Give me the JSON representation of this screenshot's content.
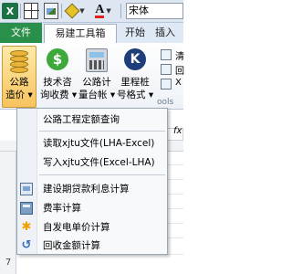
{
  "qat": {
    "excel_icon": "X",
    "font_name": "宋体",
    "font_color_glyph": "A",
    "icons": [
      "excel-icon",
      "border-icon",
      "picture-icon",
      "fill-color-icon",
      "font-color-icon"
    ],
    "colors": {
      "font_color_bar": "#e0201b",
      "excel_green": "#1e7145"
    }
  },
  "tabs": {
    "file": "文件",
    "addin": "易建工具箱",
    "home": "开始",
    "insert": "插入"
  },
  "ribbon": {
    "buttons": [
      {
        "line1": "公路",
        "line2": "造价 ▾",
        "icon": "coins-icon"
      },
      {
        "line1": "技术咨",
        "line2": "询收费 ▾",
        "icon": "dollar-icon"
      },
      {
        "line1": "公路计",
        "line2": "量台帐 ▾",
        "icon": "calculator-icon"
      },
      {
        "line1": "里程桩",
        "line2": "号格式 ▾",
        "icon": "k-icon"
      }
    ],
    "dollar_glyph": "$",
    "k_glyph": "K",
    "small_items": [
      "清",
      "回",
      "X"
    ],
    "group_label": "ools"
  },
  "menu": {
    "items": [
      {
        "label": "公路工程定额查询"
      },
      {
        "label": "读取xjtu文件(LHA-Excel)"
      },
      {
        "label": "写入xjtu文件(Excel-LHA)"
      },
      {
        "label": "建设期贷款利息计算",
        "icon": "loan-calc-icon"
      },
      {
        "label": "费率计算",
        "icon": "fee-rate-icon"
      },
      {
        "label": "自发电单价计算",
        "icon": "power-icon"
      },
      {
        "label": "回收金额计算",
        "icon": "recover-icon"
      }
    ],
    "power_glyph": "✱",
    "recover_glyph": "↺"
  },
  "sheet": {
    "fx_label": "fx",
    "row_label": "7"
  }
}
